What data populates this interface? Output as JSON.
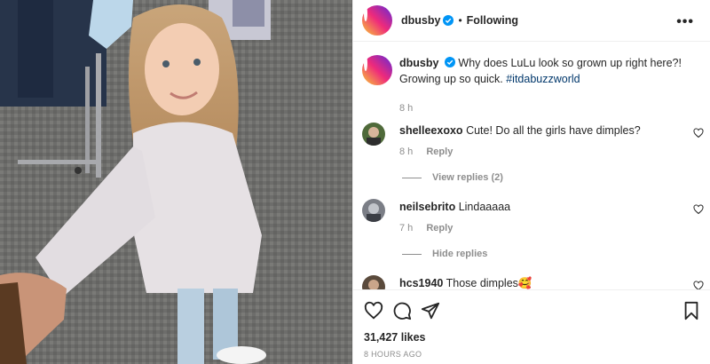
{
  "header": {
    "username": "dbusby",
    "separator": "•",
    "follow_status": "Following",
    "more_label": "•••"
  },
  "caption": {
    "username": "dbusby",
    "text": "Why does LuLu look so grown up right here?! Growing up so quick.",
    "hashtag": "#itdabuzzworld",
    "time": "8 h"
  },
  "comments": [
    {
      "username": "shelleexoxo",
      "text": "Cute! Do all the girls have dimples?",
      "time": "8 h",
      "reply_label": "Reply",
      "replies_toggle": "View replies (2)"
    },
    {
      "username": "neilsebrito",
      "text": "Lindaaaaa",
      "time": "7 h",
      "reply_label": "Reply",
      "replies_toggle": "Hide replies"
    },
    {
      "username": "hcs1940",
      "text": "Those dimples🥰"
    }
  ],
  "stats": {
    "likes": "31,427 likes",
    "posted": "8 HOURS AGO"
  },
  "icons": [
    "more-icon",
    "verified-icon",
    "heart-icon",
    "comment-icon",
    "share-icon",
    "bookmark-icon"
  ],
  "colors": {
    "verified": "#0095f6",
    "hashtag": "#00376b",
    "secondary_text": "#8e8e8e",
    "primary_text": "#262626"
  }
}
